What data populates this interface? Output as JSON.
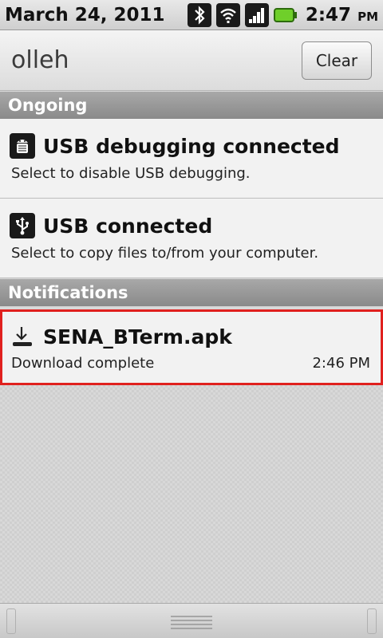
{
  "status_bar": {
    "date": "March 24, 2011",
    "time": "2:47",
    "ampm": "PM",
    "icons": [
      "bluetooth-icon",
      "wifi-icon",
      "signal-icon",
      "battery-icon"
    ]
  },
  "carrier": {
    "name": "olleh",
    "clear_label": "Clear"
  },
  "sections": {
    "ongoing": "Ongoing",
    "notifications": "Notifications"
  },
  "ongoing_items": [
    {
      "title": "USB debugging connected",
      "subtitle": "Select to disable USB debugging.",
      "icon": "android-debug-icon"
    },
    {
      "title": "USB connected",
      "subtitle": "Select to copy files to/from your computer.",
      "icon": "usb-icon"
    }
  ],
  "notification_items": [
    {
      "title": "SENA_BTerm.apk",
      "subtitle": "Download complete",
      "time": "2:46 PM",
      "icon": "download-complete-icon"
    }
  ],
  "colors": {
    "highlight_border": "#e0201e",
    "battery": "#6fcf2a"
  }
}
